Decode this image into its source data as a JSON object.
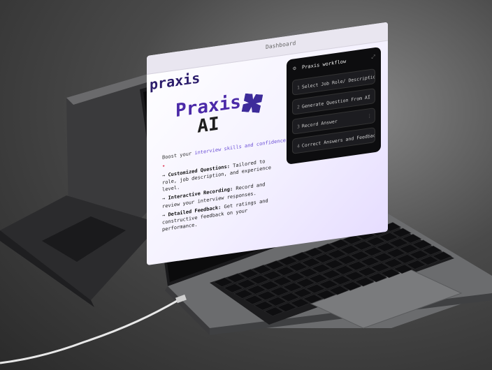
{
  "header": {
    "dashboard_label": "Dashboard"
  },
  "brand": {
    "name": "praxis"
  },
  "hero": {
    "title_line1": "Praxis",
    "title_line2": "AI",
    "tagline_prefix": "Boost your ",
    "tagline_highlight": "interview skills and confidence"
  },
  "features": [
    {
      "label": "Customized Questions:",
      "text": " Tailored to role, job description, and experience level."
    },
    {
      "label": "Interactive Recording:",
      "text": " Record and review your interview responses."
    },
    {
      "label": "Detailed Feedback:",
      "text": " Get ratings and constructive feedback on your performance."
    }
  ],
  "workflow": {
    "title": "Praxis workflow",
    "steps": [
      {
        "num": "1",
        "label": "Select Job Role/ Description"
      },
      {
        "num": "2",
        "label": "Generate Question From AI"
      },
      {
        "num": "3",
        "label": "Record Answer"
      },
      {
        "num": "4",
        "label": "Correct Answers and Feedback"
      }
    ]
  },
  "icons": {
    "workflow": "gear-icon",
    "expand": "expand-icon",
    "step_more": "more-icon",
    "logo": "praxis-logo",
    "arrow": "arrow-right-icon",
    "rocket": "rocket-icon"
  },
  "colors": {
    "accent": "#4b2aa8",
    "highlight": "#6b4fd6",
    "workflow_bg": "#0d0d0f",
    "screen_bg": "#f4f1ff"
  }
}
